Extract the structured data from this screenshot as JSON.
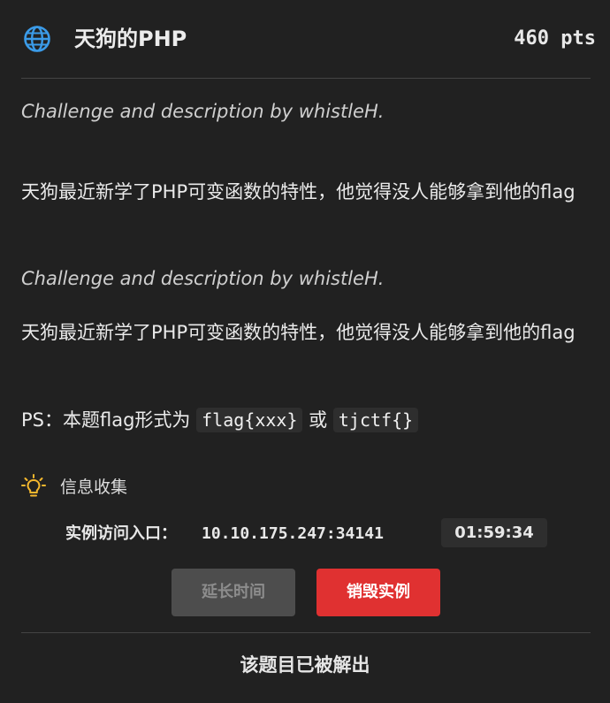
{
  "challenge": {
    "title": "天狗的PHP",
    "points": "460 pts",
    "icon": "globe-icon",
    "icon_color": "#3b9be8"
  },
  "description": {
    "author_1": "Challenge and description by whistleH.",
    "text_1": "天狗最近新学了PHP可变函数的特性，他觉得没人能够拿到他的flag",
    "author_2": "Challenge and description by whistleH.",
    "text_2": "天狗最近新学了PHP可变函数的特性，他觉得没人能够拿到他的flag",
    "ps_prefix": "PS：本题flag形式为",
    "ps_code_1": "flag{xxx}",
    "ps_or": "或",
    "ps_code_2": "tjctf{}"
  },
  "hint": {
    "icon": "lightbulb-icon",
    "icon_color": "#f5b82e",
    "label": "信息收集"
  },
  "instance": {
    "label": "实例访问入口：",
    "address": "10.10.175.247:34141",
    "timer": "01:59:34"
  },
  "buttons": {
    "extend": "延长时间",
    "destroy": "销毁实例",
    "destroy_color": "#e03131"
  },
  "status": {
    "solved": "该题目已被解出"
  }
}
